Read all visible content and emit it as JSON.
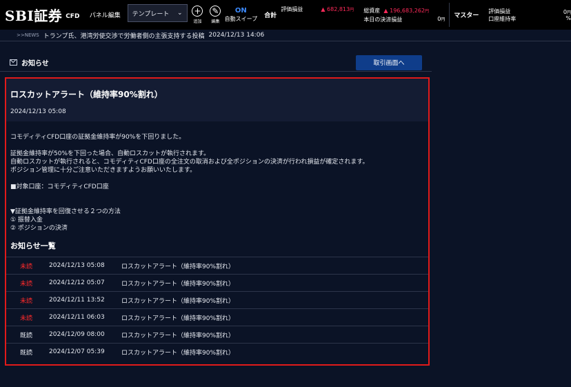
{
  "header": {
    "logo": "SBI証券",
    "logo_sub": "CFD",
    "panel_edit": "パネル編集",
    "template_select": "テンプレート",
    "tools": [
      {
        "icon": "plus-icon",
        "label": "追加"
      },
      {
        "icon": "pencil-icon",
        "label": "編集"
      }
    ],
    "auto_sweep_state": "ON",
    "auto_sweep_label": "自動スイープ",
    "summary_title": "合計",
    "summary": {
      "eval_label": "評価損益",
      "eval_value": "▲ 682,813",
      "assets_label": "総資産",
      "assets_value": "▲ 196,683,262",
      "today_label": "本日の決済損益",
      "today_value": "0",
      "yen": "円"
    },
    "master_title": "マスター",
    "master": {
      "eval_label": "評価損益",
      "eval_value": "0",
      "ratio_label": "口座維持率",
      "ratio_value": "%"
    }
  },
  "news": {
    "tag": ">>NEWS",
    "headline": "トランプ氏、港湾労使交渉で労働者側の主張支持する投稿",
    "time": "2024/12/13 14:06"
  },
  "notice": {
    "section_title": "お知らせ",
    "trade_button": "取引画面へ",
    "detail_title": "ロスカットアラート（維持率90%割れ）",
    "detail_date": "2024/12/13 05:08",
    "body": [
      "",
      "コモディティCFD口座の証拠金維持率が90%を下回りました。",
      "",
      "証拠金維持率が50%を下回った場合、自動ロスカットが執行されます。",
      "自動ロスカットが執行されると、コモディティCFD口座の全注文の取消および全ポジションの決済が行われ損益が確定されます。",
      "ポジション管理に十分ご注意いただきますようお願いいたします。",
      "",
      "■対象口座：コモディティCFD口座",
      "",
      "",
      "▼証拠金維持率を回復させる２つの方法",
      "① 振替入金",
      "② ポジションの決済"
    ],
    "list_title": "お知らせ一覧",
    "items": [
      {
        "status": "未読",
        "date": "2024/12/13 05:08",
        "title": "ロスカットアラート（維持率90%割れ）"
      },
      {
        "status": "未読",
        "date": "2024/12/12 05:07",
        "title": "ロスカットアラート（維持率90%割れ）"
      },
      {
        "status": "未読",
        "date": "2024/12/11 13:52",
        "title": "ロスカットアラート（維持率90%割れ）"
      },
      {
        "status": "未読",
        "date": "2024/12/11 06:03",
        "title": "ロスカットアラート（維持率90%割れ）"
      },
      {
        "status": "既読",
        "date": "2024/12/09 08:00",
        "title": "ロスカットアラート（維持率90%割れ）"
      },
      {
        "status": "既読",
        "date": "2024/12/07 05:39",
        "title": "ロスカットアラート（維持率90%割れ）"
      }
    ]
  },
  "colors": {
    "background": "#0b1326",
    "header_bg": "#000000",
    "accent_blue": "#3d8bff",
    "button_blue": "#0f3d8a",
    "loss_red": "#ff2a5a",
    "highlight_red": "#e21a1a"
  }
}
